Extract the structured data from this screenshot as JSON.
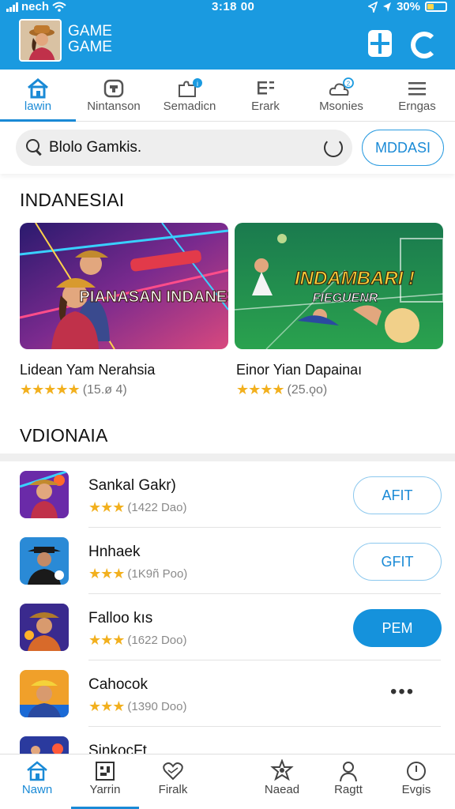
{
  "status": {
    "carrier": "nech",
    "time": "3:18 00",
    "battery": "30%"
  },
  "app": {
    "title_line1": "GAME",
    "title_line2": "GAME"
  },
  "top_tabs": [
    {
      "label": "lawin",
      "icon": "home-icon",
      "active": true
    },
    {
      "label": "Nintanson",
      "icon": "controller-icon",
      "active": false
    },
    {
      "label": "Semadicn",
      "icon": "puzzle-icon",
      "active": false
    },
    {
      "label": "Erark",
      "icon": "list-icon",
      "active": false
    },
    {
      "label": "Msonies",
      "icon": "cloud-icon",
      "active": false
    },
    {
      "label": "Erngas",
      "icon": "menu-icon",
      "active": false
    }
  ],
  "search": {
    "value": "Blolo Gamkis.",
    "action_label": "MDDASI"
  },
  "featured": {
    "title": "INDANESIAI",
    "cards": [
      {
        "banner": "PIANASAN INDANESA!",
        "name": "Lidean Yam Nerahsia",
        "rating_text": "(15.ø 4)",
        "stars": 5
      },
      {
        "banner_line1": "INDAMBARI !",
        "banner_line2": "FIEGUENR",
        "name": "Einor Yian Dapainaı",
        "rating_text": "(25.ǫo)",
        "stars": 4
      }
    ]
  },
  "list_section": {
    "title": "VDIONAIA",
    "items": [
      {
        "name": "Sankal Gakr)",
        "rating_text": "(1422 Dao)",
        "action": "AFIT",
        "action_style": "outline"
      },
      {
        "name": "Hnhaek",
        "rating_text": "(1K9ñ Poo)",
        "action": "GFIT",
        "action_style": "outline"
      },
      {
        "name": "Falloo kıs",
        "rating_text": "(1622 Doo)",
        "action": "PEM",
        "action_style": "filled"
      },
      {
        "name": "Cahocok",
        "rating_text": "(1390 Doo)",
        "action": "•••",
        "action_style": "more"
      },
      {
        "name": "SinkocFt",
        "rating_text": "",
        "action": "",
        "action_style": "none"
      }
    ]
  },
  "bottom_nav": [
    {
      "label": "Nawn",
      "icon": "home-icon",
      "active": true
    },
    {
      "label": "Yarrin",
      "icon": "grid-icon",
      "active": false
    },
    {
      "label": "Firalk",
      "icon": "heart-icon",
      "active": false
    },
    {
      "label": "Naead",
      "icon": "star-badge-icon",
      "active": false
    },
    {
      "label": "Ragtt",
      "icon": "person-icon",
      "active": false
    },
    {
      "label": "Evgis",
      "icon": "clock-icon",
      "active": false
    }
  ],
  "colors": {
    "primary": "#1a9ae0",
    "accent_text": "#1a8ad6",
    "star": "#f2b01e"
  }
}
